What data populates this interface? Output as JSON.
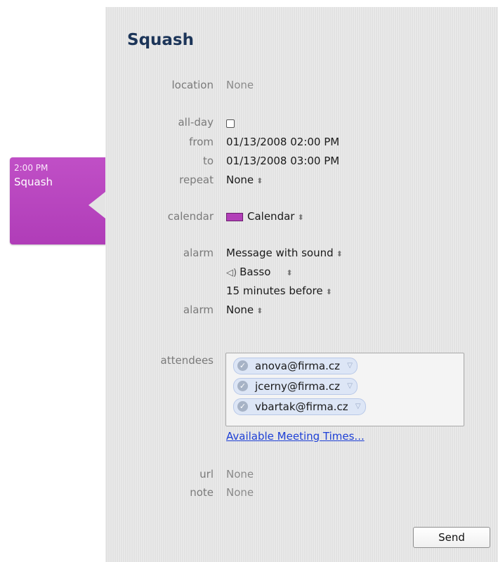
{
  "event_tab": {
    "time": "2:00 PM",
    "name": "Squash",
    "color": "#b03db8"
  },
  "panel": {
    "title": "Squash",
    "location": {
      "label": "location",
      "value": "None"
    },
    "all_day": {
      "label": "all-day",
      "checked": false
    },
    "from": {
      "label": "from",
      "value": "01/13/2008 02:00 PM"
    },
    "to": {
      "label": "to",
      "value": "01/13/2008 03:00 PM"
    },
    "repeat": {
      "label": "repeat",
      "value": "None"
    },
    "calendar": {
      "label": "calendar",
      "value": "Calendar",
      "color": "#b23fb8"
    },
    "alarm1": {
      "label": "alarm",
      "type": "Message with sound",
      "sound_icon": "speaker-icon",
      "sound": "Basso",
      "timing": "15 minutes before"
    },
    "alarm2": {
      "label": "alarm",
      "value": "None"
    },
    "attendees": {
      "label": "attendees",
      "items": [
        "anova@firma.cz",
        "jcerny@firma.cz",
        "vbartak@firma.cz"
      ],
      "meeting_times_link": "Available Meeting Times..."
    },
    "url": {
      "label": "url",
      "value": "None"
    },
    "note": {
      "label": "note",
      "value": "None"
    },
    "send_button": "Send"
  },
  "colors": {
    "panel_bg": "#e2e2e2",
    "title": "#1c3559",
    "link": "#1e40d6"
  }
}
